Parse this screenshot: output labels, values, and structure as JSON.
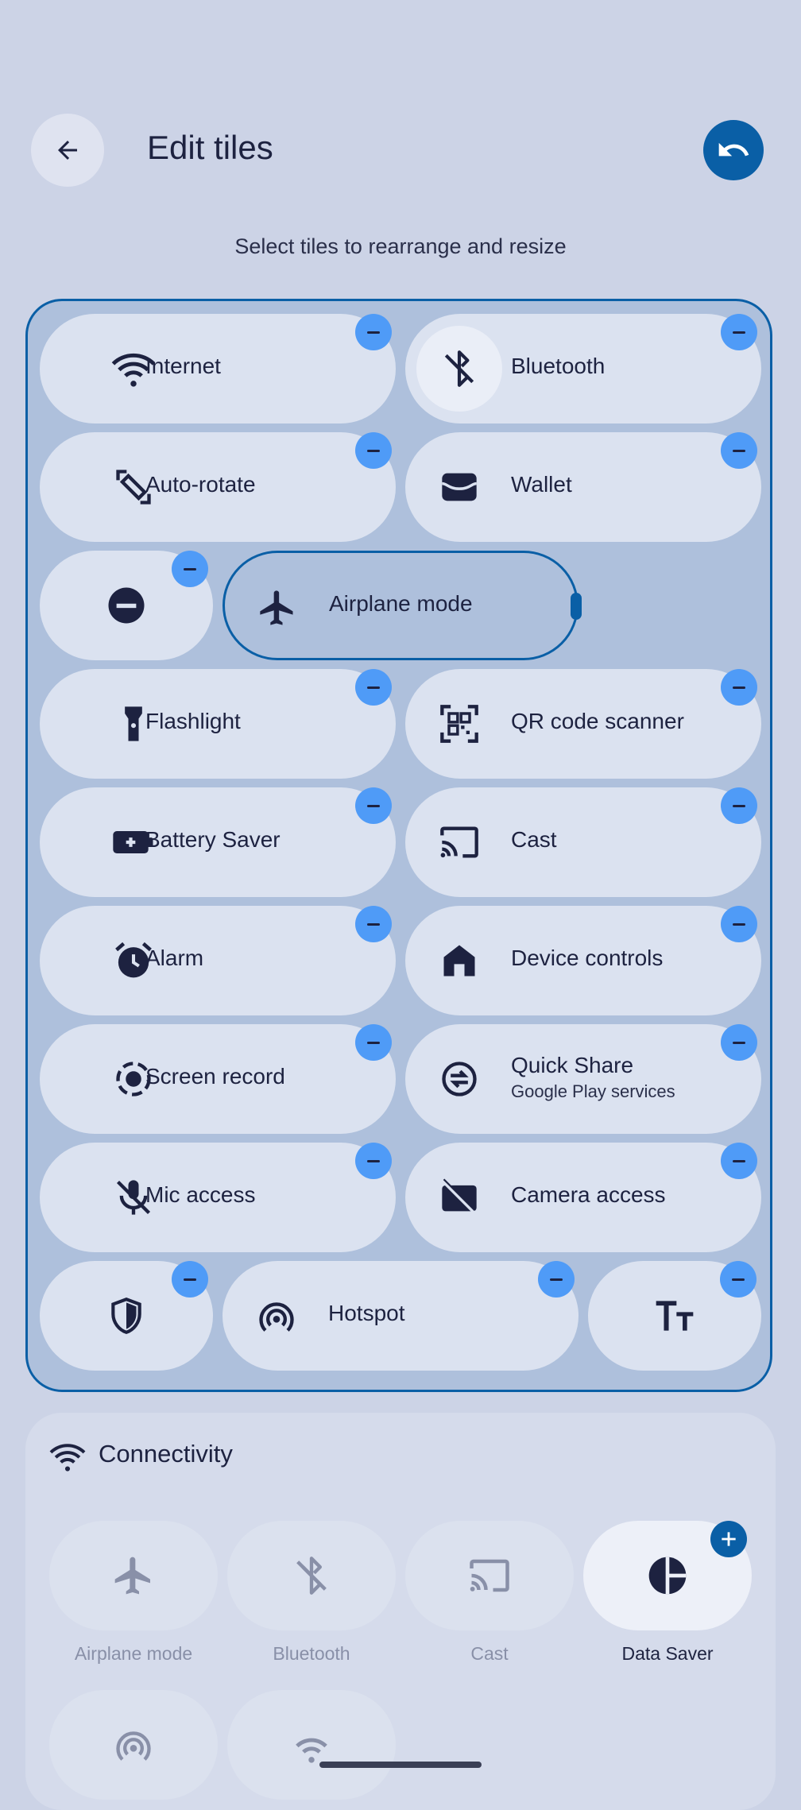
{
  "header": {
    "title": "Edit tiles",
    "subtitle": "Select tiles to rearrange and resize"
  },
  "active_tiles": {
    "internet": "Internet",
    "bluetooth": "Bluetooth",
    "auto_rotate": "Auto-rotate",
    "wallet": "Wallet",
    "airplane": "Airplane mode",
    "flashlight": "Flashlight",
    "qr": "QR code scanner",
    "battery": "Battery Saver",
    "cast": "Cast",
    "alarm": "Alarm",
    "device_controls": "Device controls",
    "screen_record": "Screen record",
    "quick_share": "Quick Share",
    "quick_share_sub": "Google Play services",
    "mic": "Mic access",
    "camera": "Camera access",
    "hotspot": "Hotspot"
  },
  "available": {
    "section_title": "Connectivity",
    "tiles": {
      "airplane": "Airplane mode",
      "bluetooth": "Bluetooth",
      "cast": "Cast",
      "data_saver": "Data Saver"
    }
  },
  "colors": {
    "accent": "#0a5fa6",
    "remove_badge": "#4f9bf7",
    "background": "#ccd3e6"
  }
}
